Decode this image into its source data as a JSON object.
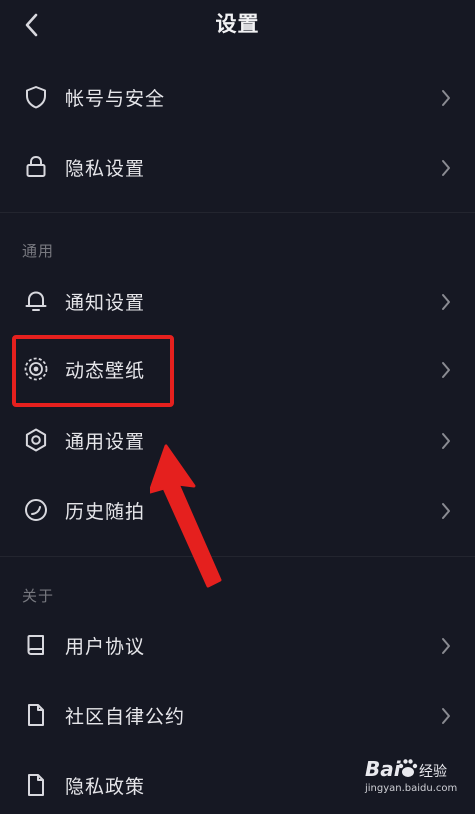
{
  "header": {
    "title": "设置"
  },
  "account": {
    "items": [
      {
        "label": "帐号与安全",
        "icon": "shield-icon"
      },
      {
        "label": "隐私设置",
        "icon": "lock-icon"
      }
    ]
  },
  "general": {
    "section_title": "通用",
    "items": [
      {
        "label": "通知设置",
        "icon": "bell-icon"
      },
      {
        "label": "动态壁纸",
        "icon": "live-wallpaper-icon"
      },
      {
        "label": "通用设置",
        "icon": "gear-icon"
      },
      {
        "label": "历史随拍",
        "icon": "history-icon"
      }
    ]
  },
  "about": {
    "section_title": "关于",
    "items": [
      {
        "label": "用户协议",
        "icon": "book-icon"
      },
      {
        "label": "社区自律公约",
        "icon": "document-icon"
      },
      {
        "label": "隐私政策",
        "icon": "document-icon"
      }
    ]
  },
  "watermark": {
    "brand": "Bai",
    "brand_cn": "经验",
    "url": "jingyan.baidu.com"
  },
  "colors": {
    "background": "#161823",
    "highlight": "#e5201e",
    "text": "#e6e6ea",
    "muted": "#77787f"
  }
}
